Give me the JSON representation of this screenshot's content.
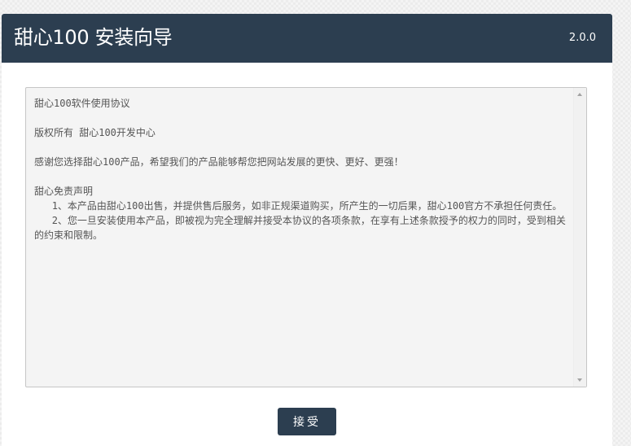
{
  "header": {
    "title": "甜心100 安装向导",
    "version": "2.0.0"
  },
  "license": {
    "text": "甜心100软件使用协议\n\n版权所有 甜心100开发中心\n\n感谢您选择甜心100产品，希望我们的产品能够帮您把网站发展的更快、更好、更强！\n\n甜心免责声明\n   1、本产品由甜心100出售，并提供售后服务，如非正规渠道购买，所产生的一切后果，甜心100官方不承担任何责任。\n   2、您一旦安装使用本产品，即被视为完全理解并接受本协议的各项条款，在享有上述条款授予的权力的同时，受到相关的约束和限制。"
  },
  "actions": {
    "accept_label": "接受"
  },
  "colors": {
    "header_bg": "#2c3e50",
    "button_bg": "#2c3e50"
  }
}
